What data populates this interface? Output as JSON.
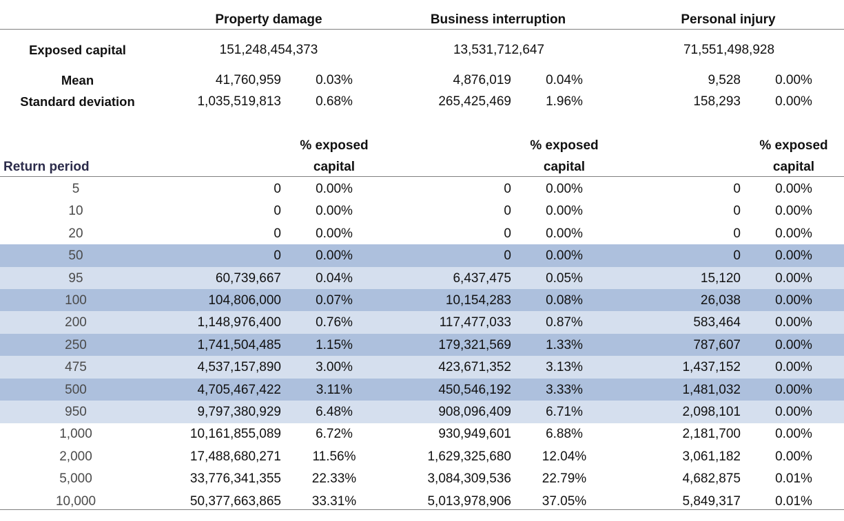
{
  "columns": [
    {
      "title": "Property damage",
      "exposed": "151,248,454,373",
      "mean": "41,760,959",
      "mean_pct": "0.03%",
      "sd": "1,035,519,813",
      "sd_pct": "0.68%"
    },
    {
      "title": "Business interruption",
      "exposed": "13,531,712,647",
      "mean": "4,876,019",
      "mean_pct": "0.04%",
      "sd": "265,425,469",
      "sd_pct": "1.96%"
    },
    {
      "title": "Personal injury",
      "exposed": "71,551,498,928",
      "mean": "9,528",
      "mean_pct": "0.00%",
      "sd": "158,293",
      "sd_pct": "0.00%"
    }
  ],
  "labels": {
    "exposed_capital": "Exposed capital",
    "mean": "Mean",
    "standard_deviation": "Standard deviation",
    "return_period": "Return period",
    "pct_exposed_line1": "% exposed",
    "pct_exposed_line2": "capital"
  },
  "rows": [
    {
      "rp": "5",
      "shade": "none",
      "v": [
        "0",
        "0.00%",
        "0",
        "0.00%",
        "0",
        "0.00%"
      ]
    },
    {
      "rp": "10",
      "shade": "none",
      "v": [
        "0",
        "0.00%",
        "0",
        "0.00%",
        "0",
        "0.00%"
      ]
    },
    {
      "rp": "20",
      "shade": "none",
      "v": [
        "0",
        "0.00%",
        "0",
        "0.00%",
        "0",
        "0.00%"
      ]
    },
    {
      "rp": "50",
      "shade": "dark",
      "v": [
        "0",
        "0.00%",
        "0",
        "0.00%",
        "0",
        "0.00%"
      ]
    },
    {
      "rp": "95",
      "shade": "light",
      "v": [
        "60,739,667",
        "0.04%",
        "6,437,475",
        "0.05%",
        "15,120",
        "0.00%"
      ]
    },
    {
      "rp": "100",
      "shade": "dark",
      "v": [
        "104,806,000",
        "0.07%",
        "10,154,283",
        "0.08%",
        "26,038",
        "0.00%"
      ]
    },
    {
      "rp": "200",
      "shade": "light",
      "v": [
        "1,148,976,400",
        "0.76%",
        "117,477,033",
        "0.87%",
        "583,464",
        "0.00%"
      ]
    },
    {
      "rp": "250",
      "shade": "dark",
      "v": [
        "1,741,504,485",
        "1.15%",
        "179,321,569",
        "1.33%",
        "787,607",
        "0.00%"
      ]
    },
    {
      "rp": "475",
      "shade": "light",
      "v": [
        "4,537,157,890",
        "3.00%",
        "423,671,352",
        "3.13%",
        "1,437,152",
        "0.00%"
      ]
    },
    {
      "rp": "500",
      "shade": "dark",
      "v": [
        "4,705,467,422",
        "3.11%",
        "450,546,192",
        "3.33%",
        "1,481,032",
        "0.00%"
      ]
    },
    {
      "rp": "950",
      "shade": "light",
      "v": [
        "9,797,380,929",
        "6.48%",
        "908,096,409",
        "6.71%",
        "2,098,101",
        "0.00%"
      ]
    },
    {
      "rp": "1,000",
      "shade": "none",
      "v": [
        "10,161,855,089",
        "6.72%",
        "930,949,601",
        "6.88%",
        "2,181,700",
        "0.00%"
      ]
    },
    {
      "rp": "2,000",
      "shade": "none",
      "v": [
        "17,488,680,271",
        "11.56%",
        "1,629,325,680",
        "12.04%",
        "3,061,182",
        "0.00%"
      ]
    },
    {
      "rp": "5,000",
      "shade": "none",
      "v": [
        "33,776,341,355",
        "22.33%",
        "3,084,309,536",
        "22.79%",
        "4,682,875",
        "0.01%"
      ]
    },
    {
      "rp": "10,000",
      "shade": "none",
      "v": [
        "50,377,663,865",
        "33.31%",
        "5,013,978,906",
        "37.05%",
        "5,849,317",
        "0.01%"
      ]
    }
  ]
}
